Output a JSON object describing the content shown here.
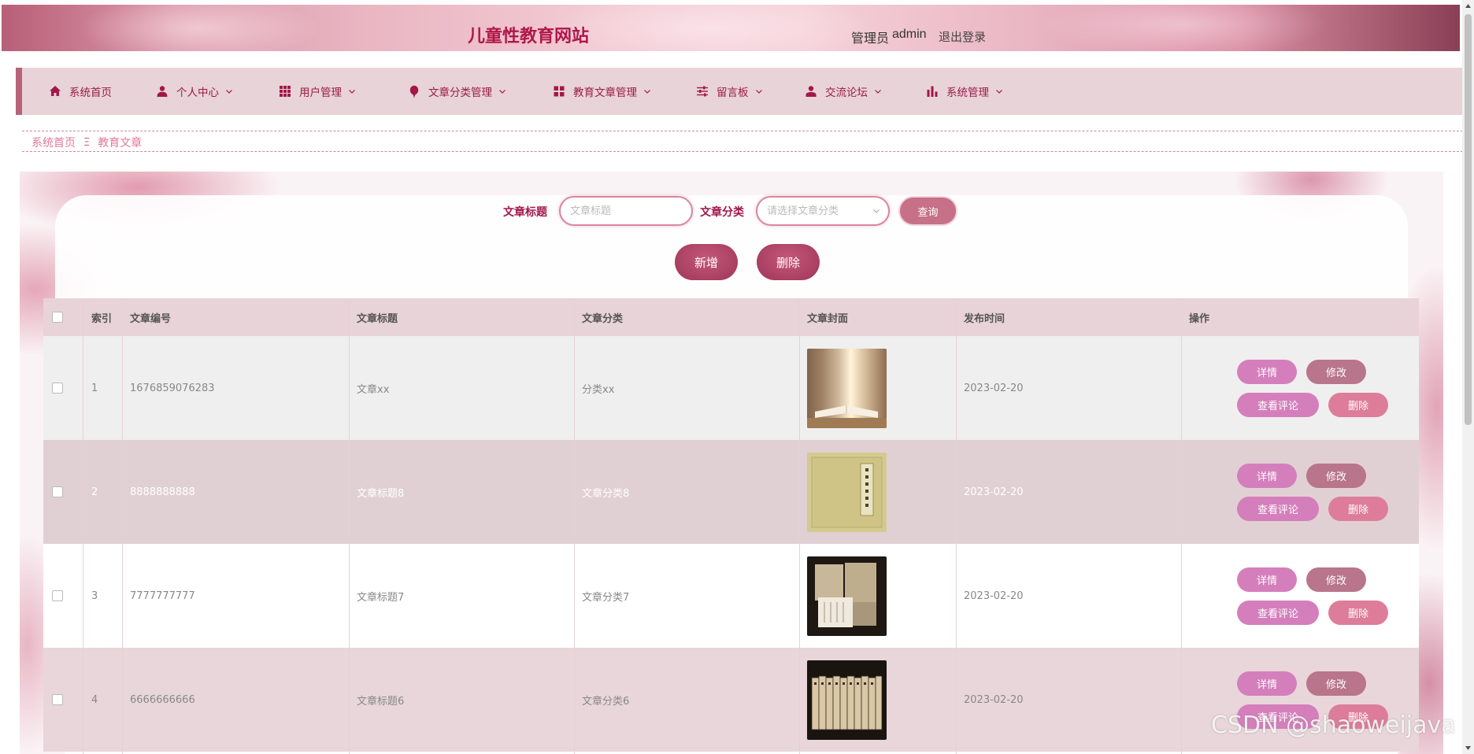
{
  "header": {
    "site_title": "儿童性教育网站",
    "admin_role": "管理员",
    "admin_name": "admin",
    "logout_label": "退出登录"
  },
  "nav": {
    "items": [
      {
        "label": "系统首页",
        "icon": "home-icon"
      },
      {
        "label": "个人中心",
        "icon": "user-icon"
      },
      {
        "label": "用户管理",
        "icon": "grid-icon"
      },
      {
        "label": "文章分类管理",
        "icon": "balloon-icon"
      },
      {
        "label": "教育文章管理",
        "icon": "apps-icon"
      },
      {
        "label": "留言板",
        "icon": "sliders-icon"
      },
      {
        "label": "交流论坛",
        "icon": "person-icon"
      },
      {
        "label": "系统管理",
        "icon": "bar-chart-icon"
      }
    ]
  },
  "breadcrumb": {
    "home": "系统首页",
    "separator": "Ξ",
    "current": "教育文章"
  },
  "search": {
    "title_label": "文章标题",
    "title_placeholder": "文章标题",
    "category_label": "文章分类",
    "category_placeholder": "请选择文章分类",
    "query_label": "查询"
  },
  "toolbar": {
    "add_label": "新增",
    "delete_label": "删除"
  },
  "table": {
    "columns": [
      "索引",
      "文章编号",
      "文章标题",
      "文章分类",
      "文章封面",
      "发布时间",
      "操作"
    ],
    "rows": [
      {
        "index": "1",
        "number": "1676859076283",
        "title": "文章xx",
        "category": "分类xx",
        "date": "2023-02-20"
      },
      {
        "index": "2",
        "number": "8888888888",
        "title": "文章标题8",
        "category": "文章分类8",
        "date": "2023-02-20"
      },
      {
        "index": "3",
        "number": "7777777777",
        "title": "文章标题7",
        "category": "文章分类7",
        "date": "2023-02-20"
      },
      {
        "index": "4",
        "number": "6666666666",
        "title": "文章标题6",
        "category": "文章分类6",
        "date": "2023-02-20"
      }
    ],
    "row_actions": {
      "detail": "详情",
      "edit": "修改",
      "comments": "查看评论",
      "delete": "删除"
    }
  },
  "watermark": "CSDN @shaoweijava",
  "colors": {
    "accent": "#a3174a",
    "nav_bg": "#e8d3d8",
    "detail_button": "#d47fbc",
    "edit_button": "#b8758b",
    "delete_button": "#dd7d9a"
  }
}
